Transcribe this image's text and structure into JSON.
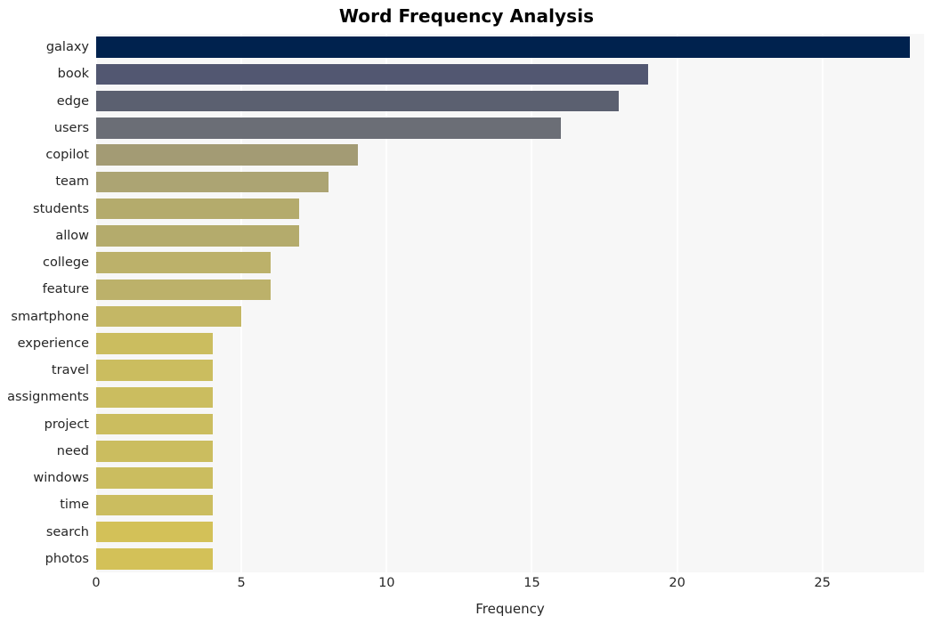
{
  "chart_data": {
    "type": "bar",
    "orientation": "horizontal",
    "title": "Word Frequency Analysis",
    "xlabel": "Frequency",
    "ylabel": "",
    "xlim": [
      0,
      28.5
    ],
    "xticks": [
      0,
      5,
      10,
      15,
      20,
      25
    ],
    "xtick_labels": [
      "0",
      "5",
      "10",
      "15",
      "20",
      "25"
    ],
    "grid": true,
    "grid_axis": "x",
    "legend": "none",
    "categories": [
      "galaxy",
      "book",
      "edge",
      "users",
      "copilot",
      "team",
      "students",
      "allow",
      "college",
      "feature",
      "smartphone",
      "experience",
      "travel",
      "assignments",
      "project",
      "need",
      "windows",
      "time",
      "search",
      "photos"
    ],
    "values": [
      28,
      19,
      18,
      16,
      9,
      8,
      7,
      7,
      6,
      6,
      5,
      4,
      4,
      4,
      4,
      4,
      4,
      4,
      4,
      4
    ],
    "bar_colors": [
      "#00224e",
      "#525771",
      "#5b6070",
      "#6b6e76",
      "#a39b74",
      "#aca473",
      "#b4ab6c",
      "#b4ab6c",
      "#bcb16a",
      "#bcb16a",
      "#c4b765",
      "#cbbd5f",
      "#cbbd5f",
      "#cbbd5f",
      "#cbbd5f",
      "#cbbd5f",
      "#cbbd5f",
      "#cbbd5f",
      "#d3c158",
      "#d3c158"
    ],
    "plot_background": "#f7f7f7",
    "grid_color": "#ffffff",
    "figure_background": "#ffffff",
    "text_color": "#262626"
  }
}
